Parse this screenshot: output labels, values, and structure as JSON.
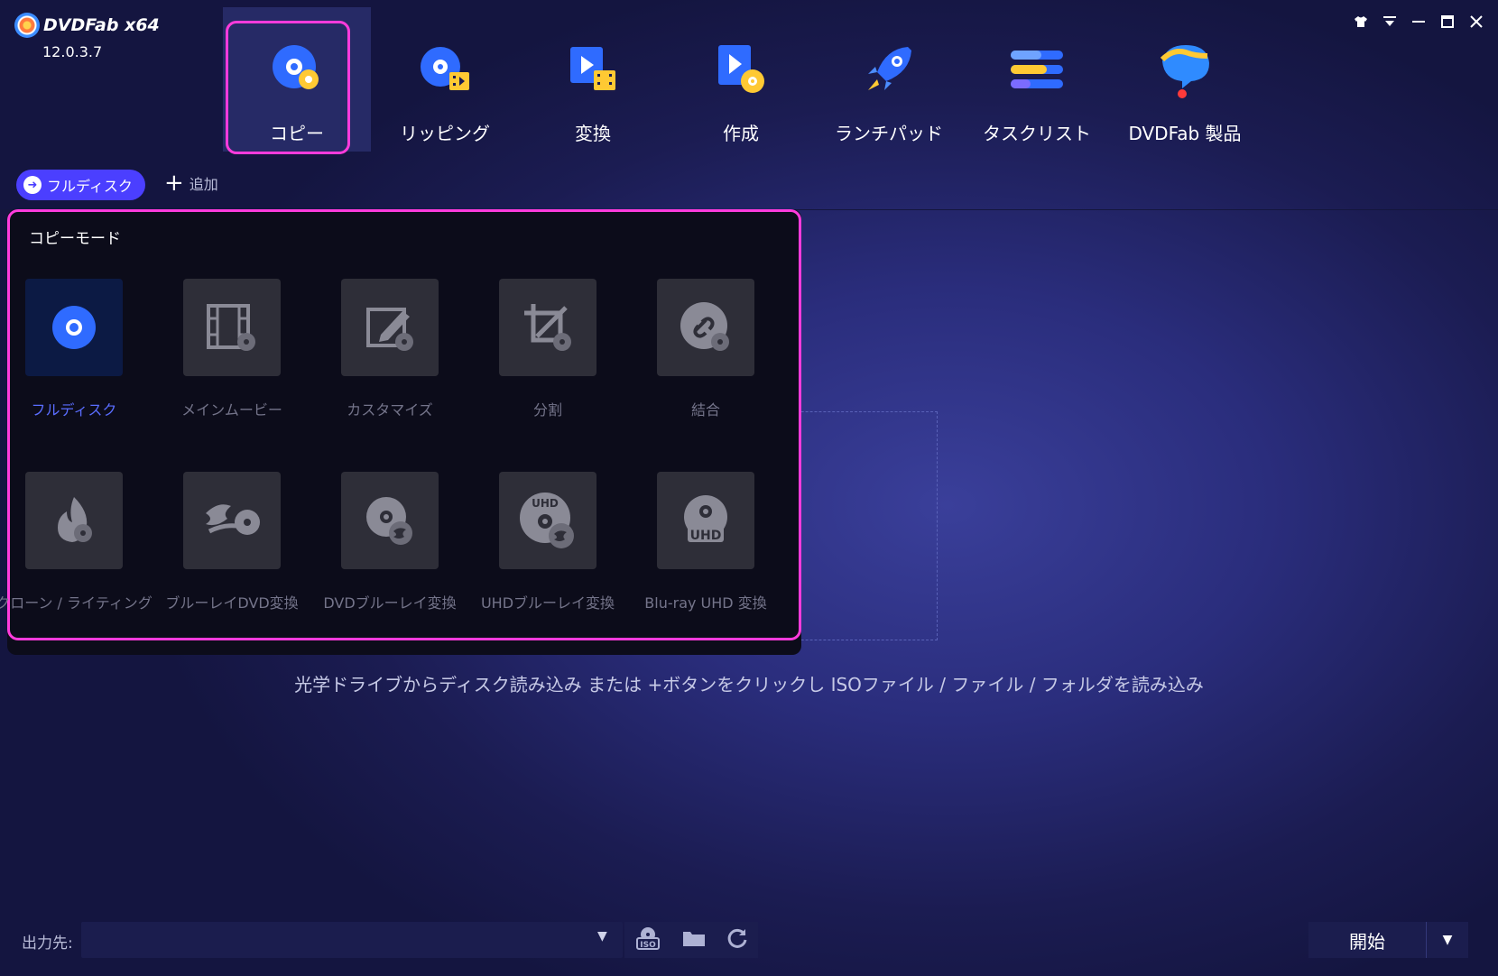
{
  "app": {
    "name": "DVDFab x64",
    "version": "12.0.3.7"
  },
  "window_controls": [
    "shirt-icon",
    "menu-icon",
    "minimize-icon",
    "maximize-icon",
    "close-icon"
  ],
  "nav": [
    {
      "label": "コピー",
      "icon": "copy-disc-icon",
      "active": true
    },
    {
      "label": "リッピング",
      "icon": "ripper-icon"
    },
    {
      "label": "変換",
      "icon": "converter-icon"
    },
    {
      "label": "作成",
      "icon": "creator-icon"
    },
    {
      "label": "ランチパッド",
      "icon": "rocket-icon"
    },
    {
      "label": "タスクリスト",
      "icon": "tasklist-icon"
    },
    {
      "label": "DVDFab 製品",
      "icon": "products-icon"
    }
  ],
  "toolbar": {
    "mode_label": "フルディスク",
    "add_label": "追加"
  },
  "panel": {
    "title": "コピーモード",
    "modes": [
      {
        "label": "フルディスク",
        "icon": "full-disc-icon",
        "selected": true
      },
      {
        "label": "メインムービー",
        "icon": "main-movie-icon"
      },
      {
        "label": "カスタマイズ",
        "icon": "customize-icon"
      },
      {
        "label": "分割",
        "icon": "split-icon"
      },
      {
        "label": "結合",
        "icon": "merge-icon"
      },
      {
        "label": "クローン / ライティング",
        "icon": "clone-burn-icon"
      },
      {
        "label": "ブルーレイDVD変換",
        "icon": "bluray-to-dvd-icon"
      },
      {
        "label": "DVDブルーレイ変換",
        "icon": "dvd-to-bluray-icon"
      },
      {
        "label": "UHDブルーレイ変換",
        "icon": "uhd-to-bluray-icon"
      },
      {
        "label": "Blu-ray UHD 変換",
        "icon": "bluray-to-uhd-icon"
      }
    ]
  },
  "drop_hint": "光学ドライブからディスク読み込み または +ボタンをクリックし ISOファイル / ファイル / フォルダを読み込み",
  "bottom": {
    "output_label": "出力先:",
    "output_value": "",
    "tools": [
      "iso-icon",
      "folder-icon",
      "refresh-icon"
    ],
    "start_label": "開始"
  },
  "colors": {
    "accent": "#4b3fff",
    "highlight": "#ff3bdc",
    "selected_text": "#5a6dff"
  }
}
